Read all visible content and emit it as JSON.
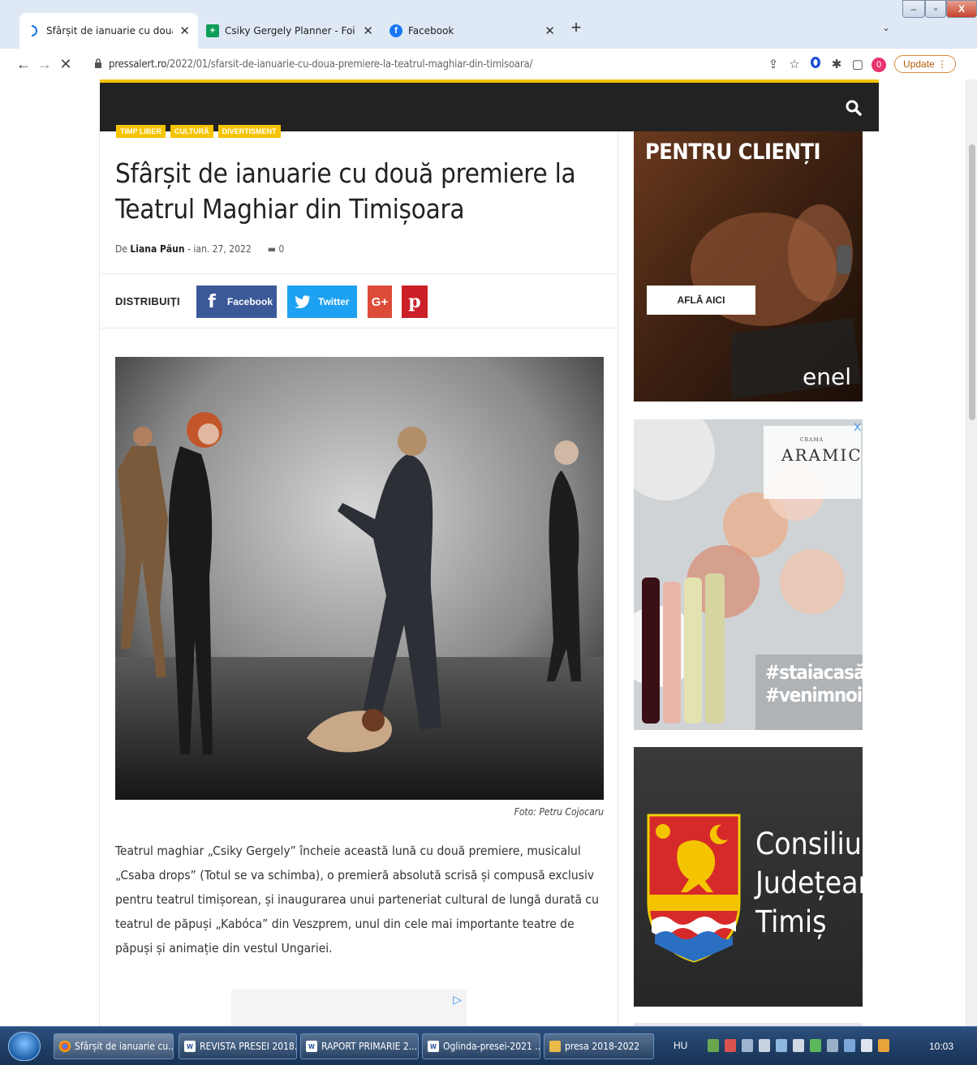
{
  "browser": {
    "tabs": [
      {
        "title": "Sfârșit de ianuarie cu două premiere",
        "active": true
      },
      {
        "title": "Csiky Gergely Planner - Foi de calcul",
        "active": false
      },
      {
        "title": "Facebook",
        "active": false
      }
    ],
    "url_host": "pressalert.ro",
    "url_path": "/2022/01/sfarsit-de-ianuarie-cu-doua-premiere-la-teatrul-maghiar-din-timisoara/",
    "update_label": "Update",
    "profile_badge": "0"
  },
  "article": {
    "categories": [
      "TIMP LIBER",
      "CULTURĂ",
      "DIVERTISMENT"
    ],
    "headline": "Sfârșit de ianuarie cu două premiere la Teatrul Maghiar din Timișoara",
    "by_prefix": "De",
    "author": "Liana Păun",
    "date": "- ian. 27, 2022",
    "comments": "0",
    "share_label": "DISTRIBUIȚI",
    "share_buttons": {
      "facebook": "Facebook",
      "twitter": "Twitter",
      "gplus": "G+",
      "pinterest": "p"
    },
    "photo_caption": "Foto: Petru Cojocaru",
    "body": "Teatrul maghiar „Csiky Gergely” încheie această lună cu două premiere, musicalul „Csaba drops” (Totul se va schimba), o premieră absolută scrisă și compusă exclusiv pentru teatrul timișorean, și inaugurarea unui parteneriat cultural de lungă durată cu teatrul de păpuși „Kabóca” din Veszprem, unul din cele mai importante teatre de păpuși și animație din vestul Ungariei."
  },
  "sidebar": {
    "ad1": {
      "headline": "PENTRU CLIENȚI",
      "button": "AFLĂ AICI",
      "brand": "enel"
    },
    "ad2": {
      "small": "CRAMA",
      "brand": "ARAMIC",
      "tag1": "#staiacasă",
      "tag2": "#venimnoilatine",
      "close": "X"
    },
    "ad3": {
      "line1": "Consiliul",
      "line2": "Județean",
      "line3": "Timiș"
    }
  },
  "taskbar": {
    "items": [
      {
        "label": "Sfârșit de ianuarie cu...",
        "icon": "chrome-icon"
      },
      {
        "label": "REVISTA PRESEI 2018...",
        "icon": "word-icon"
      },
      {
        "label": "RAPORT PRIMARIE 2...",
        "icon": "word-icon"
      },
      {
        "label": "Oglinda-presei-2021 ...",
        "icon": "word-icon"
      },
      {
        "label": "presa 2018-2022",
        "icon": "folder-icon"
      }
    ],
    "language": "HU",
    "time": "10:03"
  },
  "colors": {
    "accent": "#f5c400",
    "facebook": "#3b5998",
    "twitter": "#1da1f2",
    "gplus": "#dd4b39",
    "pinterest": "#cb2027"
  }
}
